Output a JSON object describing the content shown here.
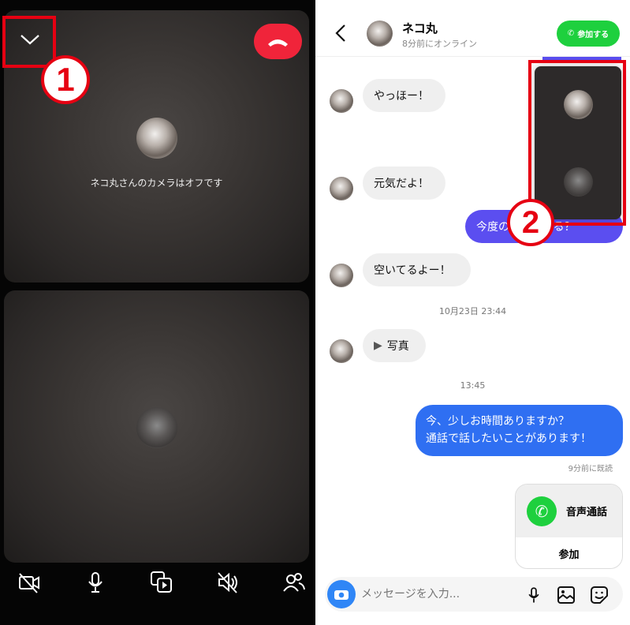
{
  "call": {
    "camera_off_text": "ネコ丸さんのカメラはオフです",
    "annotation_1": "1",
    "end_color": "#f0243a"
  },
  "controls": [
    {
      "icon": "video-off-icon"
    },
    {
      "icon": "microphone-icon"
    },
    {
      "icon": "media-share-icon"
    },
    {
      "icon": "speaker-mute-icon"
    },
    {
      "icon": "people-icon"
    }
  ],
  "header": {
    "name": "ネコ丸",
    "status": "8分前にオンライン",
    "join_label": "参加する",
    "join_color": "#1ed03e"
  },
  "messages": [
    {
      "side": "in",
      "text": "やっほー！"
    },
    {
      "side": "in",
      "text": "元気だよ！"
    },
    {
      "side": "out",
      "text": "今度の日空いてる？"
    },
    {
      "side": "in",
      "text": "空いてるよー！"
    },
    {
      "timestamp": "10月23日 23:44"
    },
    {
      "side": "in",
      "text": "写真"
    },
    {
      "timestamp": "13:45"
    },
    {
      "side": "out",
      "lines": [
        "今、少しお時間ありますか？",
        "通話で話したいことがあります！"
      ]
    }
  ],
  "read_receipt": "9分前に既読",
  "call_card": {
    "title": "音声通話",
    "action": "参加"
  },
  "pip": {
    "annotation_2": "2"
  },
  "composer": {
    "placeholder": "メッセージを入力..."
  },
  "colors": {
    "out_bubble": "#5b4ef0",
    "out_bubble_blue": "#2f6ff2",
    "annotation": "#e60012"
  }
}
